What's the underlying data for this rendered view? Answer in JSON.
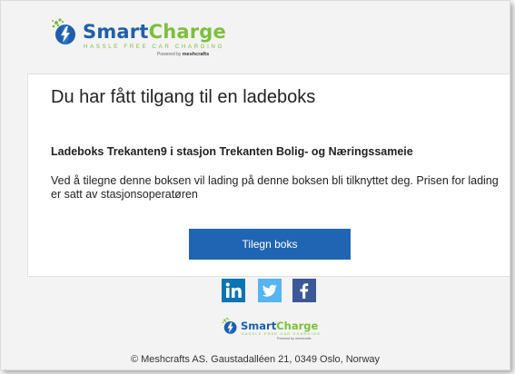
{
  "brand": {
    "name_part1": "Smart",
    "name_part2": "Charge",
    "tagline": "HASSLE FREE CAR CHARGING",
    "powered_prefix": "Powered by",
    "powered_company": "meshcrafts",
    "colors": {
      "blue": "#1f5fa9",
      "green": "#7cbf3b"
    }
  },
  "card": {
    "title": "Du har fått tilgang til en ladeboks",
    "subtitle": "Ladeboks Trekanten9 i stasjon Trekanten Bolig- og Næringssameie",
    "body": "Ved å tilegne denne boksen vil lading på denne boksen bli tilknyttet deg. Prisen for lading er satt av stasjonsoperatøren",
    "button_label": "Tilegn boks",
    "button_color": "#2065b3"
  },
  "social": {
    "linkedin_icon": "linkedin-icon",
    "twitter_icon": "twitter-icon",
    "facebook_icon": "facebook-icon"
  },
  "footer": {
    "copyright": "© Meshcrafts AS. Gaustadalléen 21, 0349 Oslo, Norway"
  }
}
